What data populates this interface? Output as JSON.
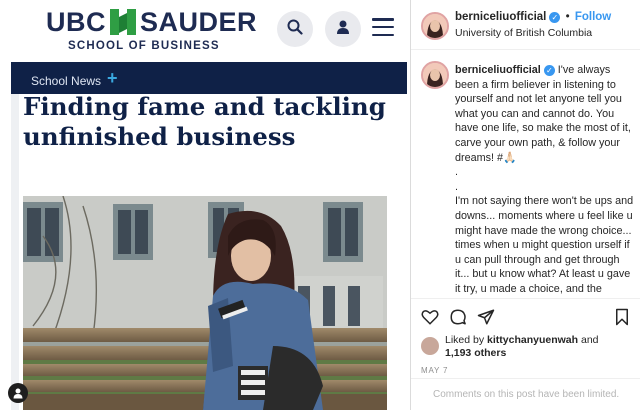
{
  "site": {
    "logo_top": "UBC",
    "logo_top_right": "SAUDER",
    "logo_sub": "SCHOOL OF BUSINESS",
    "search_icon": "search-icon",
    "account_icon": "user-icon",
    "menu_icon": "hamburger-icon",
    "nav_tab": "School News",
    "nav_plus": "+",
    "headline": "Finding fame and tackling unfinished business",
    "colors": {
      "navy": "#0f2147",
      "green": "#2f9e44",
      "accent": "#3aa8e0"
    }
  },
  "instagram": {
    "username": "berniceliuofficial",
    "follow": "Follow",
    "dot": "•",
    "location": "University of British Columbia",
    "more": "•••",
    "caption_name": "berniceliuofficial",
    "caption_lines": [
      "I've always been a firm believer in listening to yourself and not let anyone tell you what you can and cannot do. You have one life, so make the most of it, carve your own path, & follow your dreams! #🙏🏻",
      ".",
      ".",
      "I'm not saying there won't be ups and downs... moments where u feel like u might have made the wrong choice... times when u might question urself if u can pull through and get through it... but u know what? At least u gave it try, u made a choice, and the decision (mistake or achievement) was urs to make. Learn from the experience, rise above the challenges, and be a better u! #💙 ."
    ],
    "liked_by_prefix": "Liked by ",
    "liked_by_user": "kittychanyuenwah",
    "liked_by_and": " and",
    "likes_others": "1,193 others",
    "date": "MAY 7",
    "comments_limited": "Comments on this post have been limited.",
    "colors": {
      "link": "#3897f0",
      "text": "#262626",
      "muted": "#8e8e8e"
    }
  }
}
